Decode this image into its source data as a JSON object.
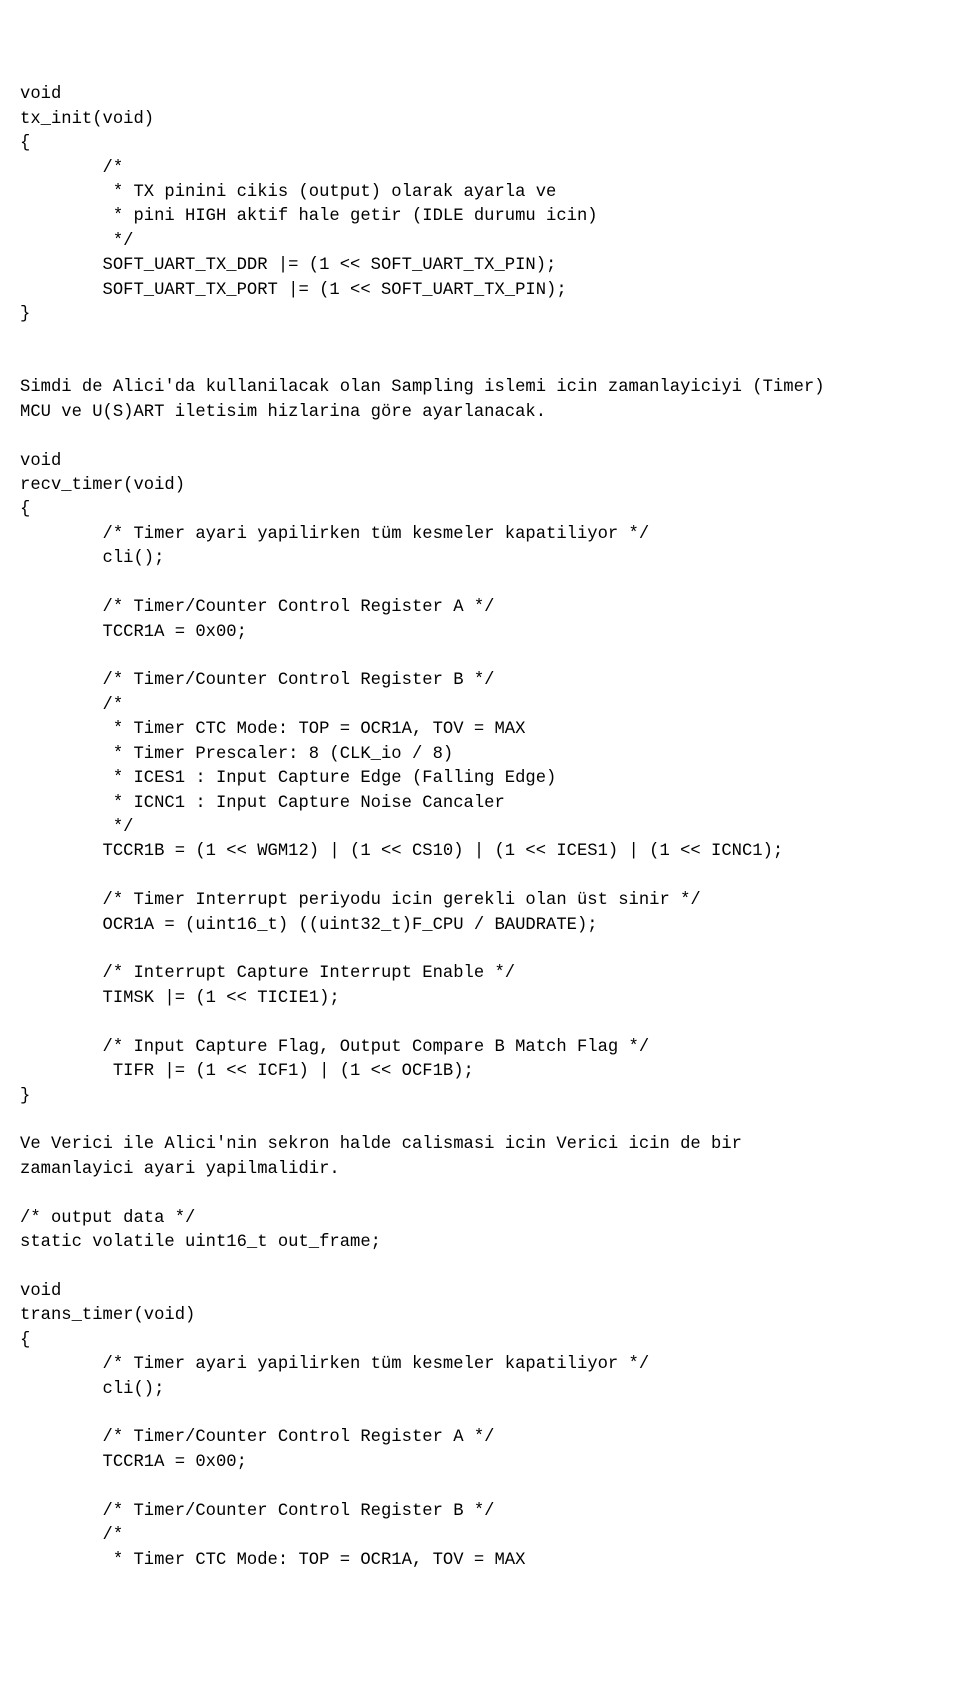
{
  "code": "void\ntx_init(void)\n{\n        /*\n         * TX pinini cikis (output) olarak ayarla ve\n         * pini HIGH aktif hale getir (IDLE durumu icin)\n         */\n        SOFT_UART_TX_DDR |= (1 << SOFT_UART_TX_PIN);\n        SOFT_UART_TX_PORT |= (1 << SOFT_UART_TX_PIN);\n}\n\n\nSimdi de Alici'da kullanilacak olan Sampling islemi icin zamanlayiciyi (Timer)\nMCU ve U(S)ART iletisim hizlarina göre ayarlanacak.\n\nvoid\nrecv_timer(void)\n{\n        /* Timer ayari yapilirken tüm kesmeler kapatiliyor */\n        cli();\n\n        /* Timer/Counter Control Register A */\n        TCCR1A = 0x00;\n\n        /* Timer/Counter Control Register B */\n        /*\n         * Timer CTC Mode: TOP = OCR1A, TOV = MAX\n         * Timer Prescaler: 8 (CLK_io / 8)\n         * ICES1 : Input Capture Edge (Falling Edge)\n         * ICNC1 : Input Capture Noise Cancaler\n         */\n        TCCR1B = (1 << WGM12) | (1 << CS10) | (1 << ICES1) | (1 << ICNC1);\n\n        /* Timer Interrupt periyodu icin gerekli olan üst sinir */\n        OCR1A = (uint16_t) ((uint32_t)F_CPU / BAUDRATE);\n\n        /* Interrupt Capture Interrupt Enable */\n        TIMSK |= (1 << TICIE1);\n\n        /* Input Capture Flag, Output Compare B Match Flag */\n         TIFR |= (1 << ICF1) | (1 << OCF1B);\n}\n\nVe Verici ile Alici'nin sekron halde calismasi icin Verici icin de bir\nzamanlayici ayari yapilmalidir.\n\n/* output data */\nstatic volatile uint16_t out_frame;\n\nvoid\ntrans_timer(void)\n{\n        /* Timer ayari yapilirken tüm kesmeler kapatiliyor */\n        cli();\n\n        /* Timer/Counter Control Register A */\n        TCCR1A = 0x00;\n\n        /* Timer/Counter Control Register B */\n        /*\n         * Timer CTC Mode: TOP = OCR1A, TOV = MAX"
}
